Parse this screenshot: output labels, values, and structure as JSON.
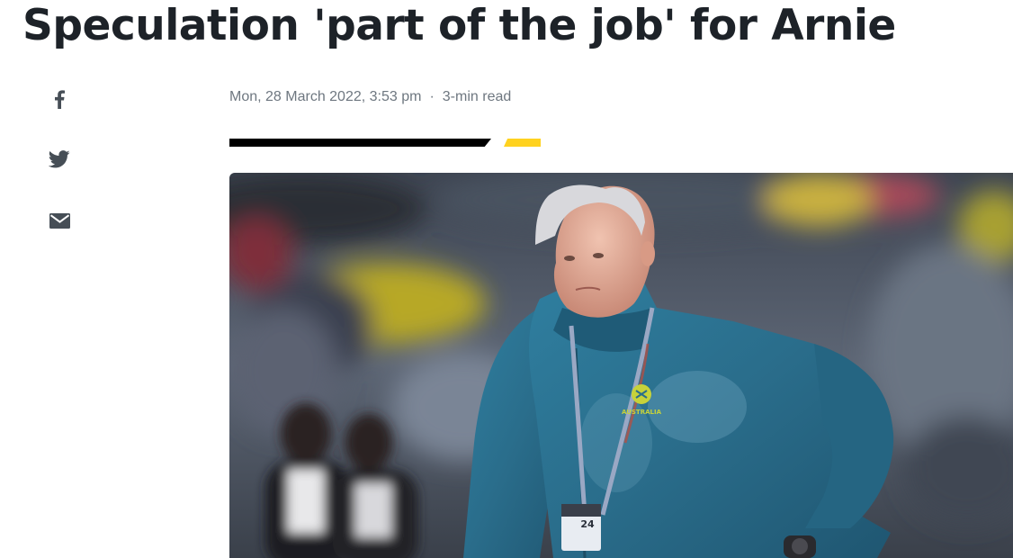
{
  "article": {
    "headline": "Speculation 'part of the job' for Arnie",
    "date": "Mon, 28 March 2022, 3:53 pm",
    "separator": "·",
    "read_time": "3-min read",
    "hero_image": {
      "jacket_logo_text": "AUSTRALIA",
      "lanyard_badge_text": "24"
    }
  },
  "share": {
    "facebook_icon": "f",
    "twitter_icon": "twitter-bird",
    "email_icon": "envelope"
  },
  "colors": {
    "headline": "#1d2228",
    "meta": "#6e7780",
    "icons": "#464e56",
    "accent_yellow": "#ffd21f",
    "rule_black": "#000000"
  }
}
